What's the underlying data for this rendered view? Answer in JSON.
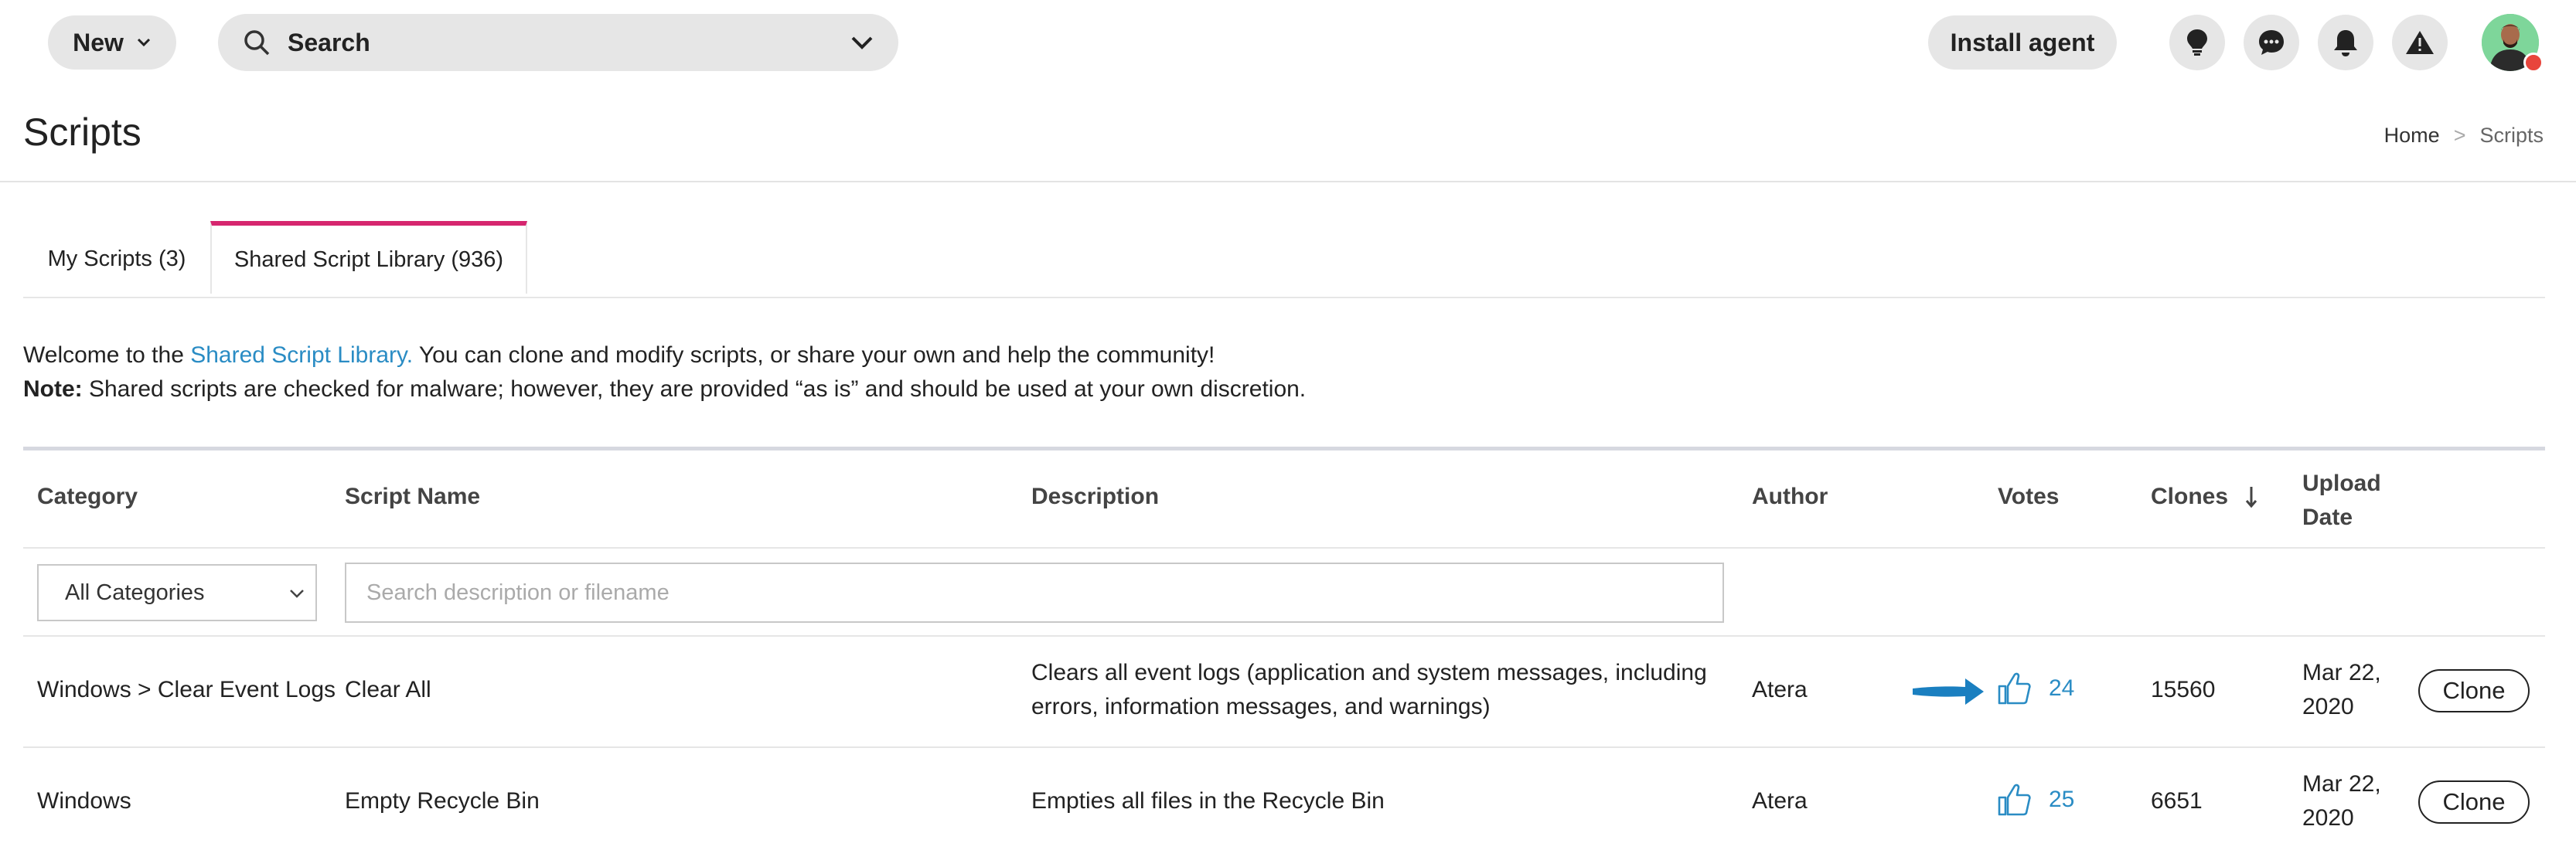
{
  "topbar": {
    "new_label": "New",
    "search_label": "Search",
    "install_label": "Install agent",
    "icons": [
      "lightbulb-icon",
      "chat-icon",
      "bell-icon",
      "alert-icon"
    ]
  },
  "page": {
    "title": "Scripts",
    "breadcrumb": {
      "home": "Home",
      "sep": ">",
      "current": "Scripts"
    }
  },
  "tabs": [
    {
      "label": "My Scripts (3)",
      "active": false
    },
    {
      "label": "Shared Script Library (936)",
      "active": true
    }
  ],
  "intro": {
    "welcome_prefix": "Welcome to the ",
    "welcome_link": "Shared Script Library.",
    "welcome_suffix": " You can clone and modify scripts, or share your own and help the community!",
    "note_label": "Note:",
    "note_text": " Shared scripts are checked for malware; however, they are provided “as is” and should be used at your own discretion."
  },
  "table": {
    "headers": {
      "category": "Category",
      "script_name": "Script Name",
      "description": "Description",
      "author": "Author",
      "votes": "Votes",
      "clones": "Clones",
      "upload_date_1": "Upload",
      "upload_date_2": "Date"
    },
    "filters": {
      "category_selected": "All Categories",
      "search_placeholder": "Search description or filename"
    },
    "rows": [
      {
        "category": "Windows > Clear Event Logs",
        "name": "Clear All",
        "description_1": "Clears all event logs (application and system messages, including",
        "description_2": "errors, information messages, and warnings)",
        "author": "Atera",
        "votes": "24",
        "clones": "15560",
        "date_1": "Mar 22,",
        "date_2": "2020",
        "action": "Clone"
      },
      {
        "category": "Windows",
        "name": "Empty Recycle Bin",
        "description_1": "Empties all files in the Recycle Bin",
        "author": "Atera",
        "votes": "25",
        "clones": "6651",
        "date_1": "Mar 22,",
        "date_2": "2020",
        "action": "Clone"
      }
    ]
  },
  "colors": {
    "accent_tab": "#d6266f",
    "link": "#2a8cc4",
    "arrow": "#1a7fc0",
    "pill_bg": "#e6e6e6"
  }
}
